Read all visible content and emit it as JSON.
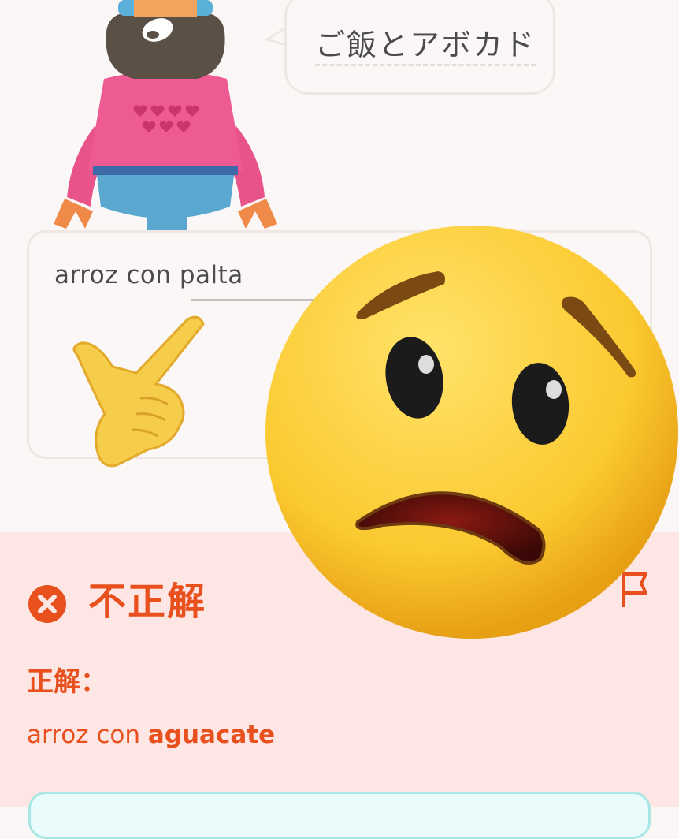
{
  "bubble": {
    "text": "ご飯とアボカド"
  },
  "answer": {
    "user_text": "arroz con palta"
  },
  "feedback": {
    "title": "不正解",
    "correct_label": "正解：",
    "correct_prefix": "arroz con ",
    "correct_highlight": "aguacate"
  },
  "colors": {
    "error_orange": "#e8501e",
    "feedback_bg": "#fde6e3",
    "page_bg": "#faf7f6"
  },
  "icons": {
    "character": "duolingo-character-illustration",
    "pointing_hand": "pointing-hand-emoji",
    "emoji_overlay": "worried-face-emoji",
    "incorrect": "x-circle-icon",
    "report": "flag-icon"
  }
}
